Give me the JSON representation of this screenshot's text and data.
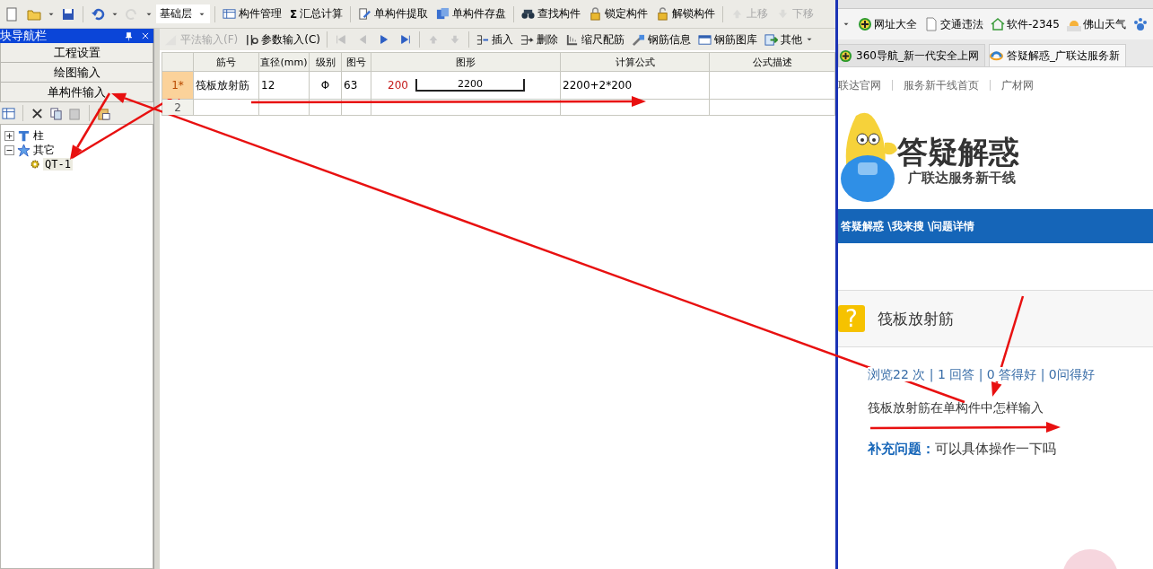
{
  "toolbar": {
    "quick_buttons": [
      {
        "disabled": false
      },
      {
        "disabled": false
      },
      {
        "disabled": false
      },
      {
        "disabled": false
      },
      {
        "disabled": true
      }
    ],
    "layer": "基础层",
    "buttons": [
      {
        "label": "构件管理",
        "disabled": false
      },
      {
        "label": "汇总计算",
        "icon_text": "Σ",
        "disabled": false
      },
      {
        "label": "单构件提取",
        "disabled": false
      },
      {
        "label": "单构件存盘",
        "disabled": false
      },
      {
        "label": "查找构件",
        "disabled": false
      },
      {
        "label": "锁定构件",
        "disabled": false
      },
      {
        "label": "解锁构件",
        "disabled": false
      },
      {
        "label": "上移",
        "disabled": true
      },
      {
        "label": "下移",
        "disabled": true
      }
    ]
  },
  "nav_panel": {
    "title": "块导航栏",
    "sections": [
      "工程设置",
      "绘图输入",
      "单构件输入"
    ],
    "tree": [
      {
        "label": "柱",
        "expanded": false
      },
      {
        "label": "其它",
        "expanded": true,
        "children": [
          {
            "label": "QT-1",
            "selected": true
          }
        ]
      }
    ]
  },
  "editor_toolbar": {
    "buttons": [
      {
        "label": "平法输入(F)",
        "disabled": true
      },
      {
        "label": "参数输入(C)",
        "disabled": false
      }
    ],
    "nav_buttons": [
      {
        "disabled": true
      },
      {
        "disabled": true
      },
      {
        "disabled": false
      },
      {
        "disabled": false
      },
      {
        "disabled": true
      },
      {
        "disabled": true
      }
    ],
    "actions": [
      {
        "label": "插入"
      },
      {
        "label": "删除"
      },
      {
        "label": "缩尺配筋"
      },
      {
        "label": "钢筋信息"
      },
      {
        "label": "钢筋图库"
      },
      {
        "label": "其他"
      }
    ]
  },
  "table": {
    "columns": [
      "筋号",
      "直径(mm)",
      "级别",
      "图号",
      "图形",
      "计算公式",
      "公式描述"
    ],
    "rows": [
      {
        "number": "1*",
        "selected": true,
        "bar_name": "筏板放射筋",
        "diameter": "12",
        "grade": "Φ",
        "shape_code": "63",
        "shape": {
          "hook": "200",
          "length": "2200"
        },
        "formula": "2200+2*200"
      },
      {
        "number": "2",
        "selected": false
      }
    ]
  },
  "browser": {
    "bookmarks": [
      "网址大全",
      "交通违法",
      "软件-2345",
      "佛山天气"
    ],
    "tabs": [
      {
        "label": "360导航_新一代安全上网",
        "selected": false
      },
      {
        "label": "答疑解惑_广联达服务新",
        "selected": true
      }
    ],
    "links": [
      "联达官网",
      "服务新干线首页",
      "广材网"
    ],
    "logo": {
      "title": "答疑解惑",
      "subtitle": "广联达服务新干线"
    },
    "breadcrumb": "答疑解惑 \\我来搜 \\问题详情",
    "question": {
      "badge": "?",
      "title": "筏板放射筋",
      "stats": "浏览22 次 | 1 回答 | 0 答得好 | 0问得好",
      "body": "筏板放射筋在单构件中怎样输入",
      "supplement": "**补充问题：**可以具体操作一下吗"
    }
  }
}
